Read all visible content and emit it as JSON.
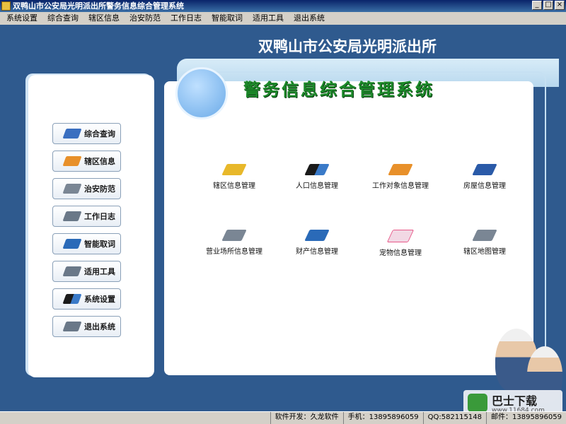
{
  "window": {
    "title": "双鸭山市公安局光明派出所警务信息综合管理系统"
  },
  "menubar": [
    "系统设置",
    "综合查询",
    "辖区信息",
    "治安防范",
    "工作日志",
    "智能取词",
    "适用工具",
    "退出系统"
  ],
  "header": {
    "police_station": "双鸭山市公安局光明派出所"
  },
  "left_nav": [
    {
      "label": "综合查询",
      "icon": "search-icon",
      "color": "#3a6fc0"
    },
    {
      "label": "辖区信息",
      "icon": "rss-icon",
      "color": "#e8902a"
    },
    {
      "label": "治安防范",
      "icon": "shield-icon",
      "color": "#7a8694"
    },
    {
      "label": "工作日志",
      "icon": "note-icon",
      "color": "#6a7888"
    },
    {
      "label": "智能取词",
      "icon": "dictionary-icon",
      "color": "#2a6ab8"
    },
    {
      "label": "适用工具",
      "icon": "tool-icon",
      "color": "#6a7888"
    },
    {
      "label": "系统设置",
      "icon": "settings-icon",
      "color": "#1a1a1a"
    },
    {
      "label": "退出系统",
      "icon": "exit-icon",
      "color": "#6a7888"
    }
  ],
  "main": {
    "system_title": "警务信息综合管理系统",
    "tiles": [
      {
        "label": "辖区信息管理",
        "icon": "area-icon",
        "color": "#e8b82a"
      },
      {
        "label": "人口信息管理",
        "icon": "population-icon",
        "color": "#2a3a5a"
      },
      {
        "label": "工作对象信息管理",
        "icon": "target-icon",
        "color": "#e8902a"
      },
      {
        "label": "房屋信息管理",
        "icon": "house-icon",
        "color": "#2a5aa8"
      },
      {
        "label": "营业场所信息管理",
        "icon": "business-icon",
        "color": "#7a8694"
      },
      {
        "label": "财产信息管理",
        "icon": "property-icon",
        "color": "#2a6ab8"
      },
      {
        "label": "宠物信息管理",
        "icon": "pet-icon",
        "color": "#e85a8a"
      },
      {
        "label": "辖区地图管理",
        "icon": "map-icon",
        "color": "#7a8694"
      }
    ]
  },
  "watermark": {
    "text": "巴士下载",
    "url": "www.11684.com"
  },
  "statusbar": [
    "软件开发：久龙软件",
    "手机：13895896059",
    "QQ:582115148",
    "邮件：13895896059"
  ]
}
